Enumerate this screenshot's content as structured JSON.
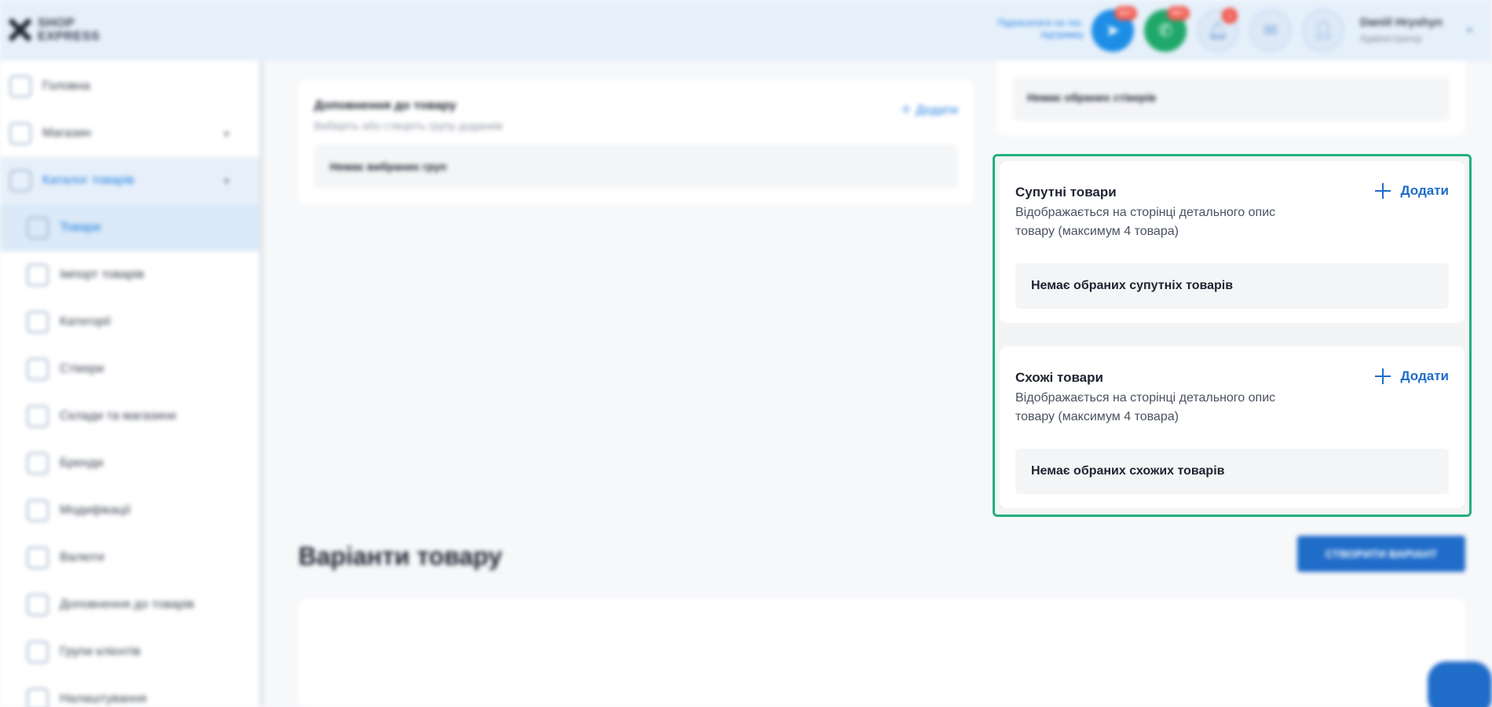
{
  "header": {
    "logo_line1": "SHOP",
    "logo_line2": "EXPRESS",
    "link_text": "Підписатися на тех. підтримку",
    "telegram_badge": "99+",
    "viber_badge": "99+",
    "bell_badge": "1",
    "user_name": "Daniil Hryshyn",
    "user_role": "Адміністратор"
  },
  "sidebar": {
    "items": [
      {
        "label": "Головна"
      },
      {
        "label": "Магазин"
      },
      {
        "label": "Каталог товарів"
      },
      {
        "label": "Товари"
      },
      {
        "label": "Імпорт товарів"
      },
      {
        "label": "Категорії"
      },
      {
        "label": "Стікери"
      },
      {
        "label": "Склади та магазини"
      },
      {
        "label": "Бренди"
      },
      {
        "label": "Модифікації"
      },
      {
        "label": "Валюти"
      },
      {
        "label": "Доповнення до товарів"
      },
      {
        "label": "Групи клієнтів"
      },
      {
        "label": "Налаштування"
      }
    ]
  },
  "left_card": {
    "title": "Доповнення до товару",
    "subtitle": "Виберіть або створіть групу доданків",
    "add_label": "Додати",
    "empty_text": "Немає вибраних груп"
  },
  "right_top_card": {
    "empty_text": "Немає обраних стікерів"
  },
  "related": {
    "title": "Супутні товари",
    "description": "Відображається на сторінці детального опис товару (максимум 4 товара)",
    "add_label": "Додати",
    "empty_text": "Немає обраних супутніх товарів"
  },
  "similar": {
    "title": "Схожі товари",
    "description": "Відображається на сторінці детального опис товару (максимум 4 товара)",
    "add_label": "Додати",
    "empty_text": "Немає обраних схожих товарів"
  },
  "variants": {
    "title": "Варіанти товару",
    "create_label": "СТВОРИТИ ВАРІАНТ"
  },
  "colors": {
    "accent": "#1f6cc9",
    "highlight": "#22b07d"
  }
}
